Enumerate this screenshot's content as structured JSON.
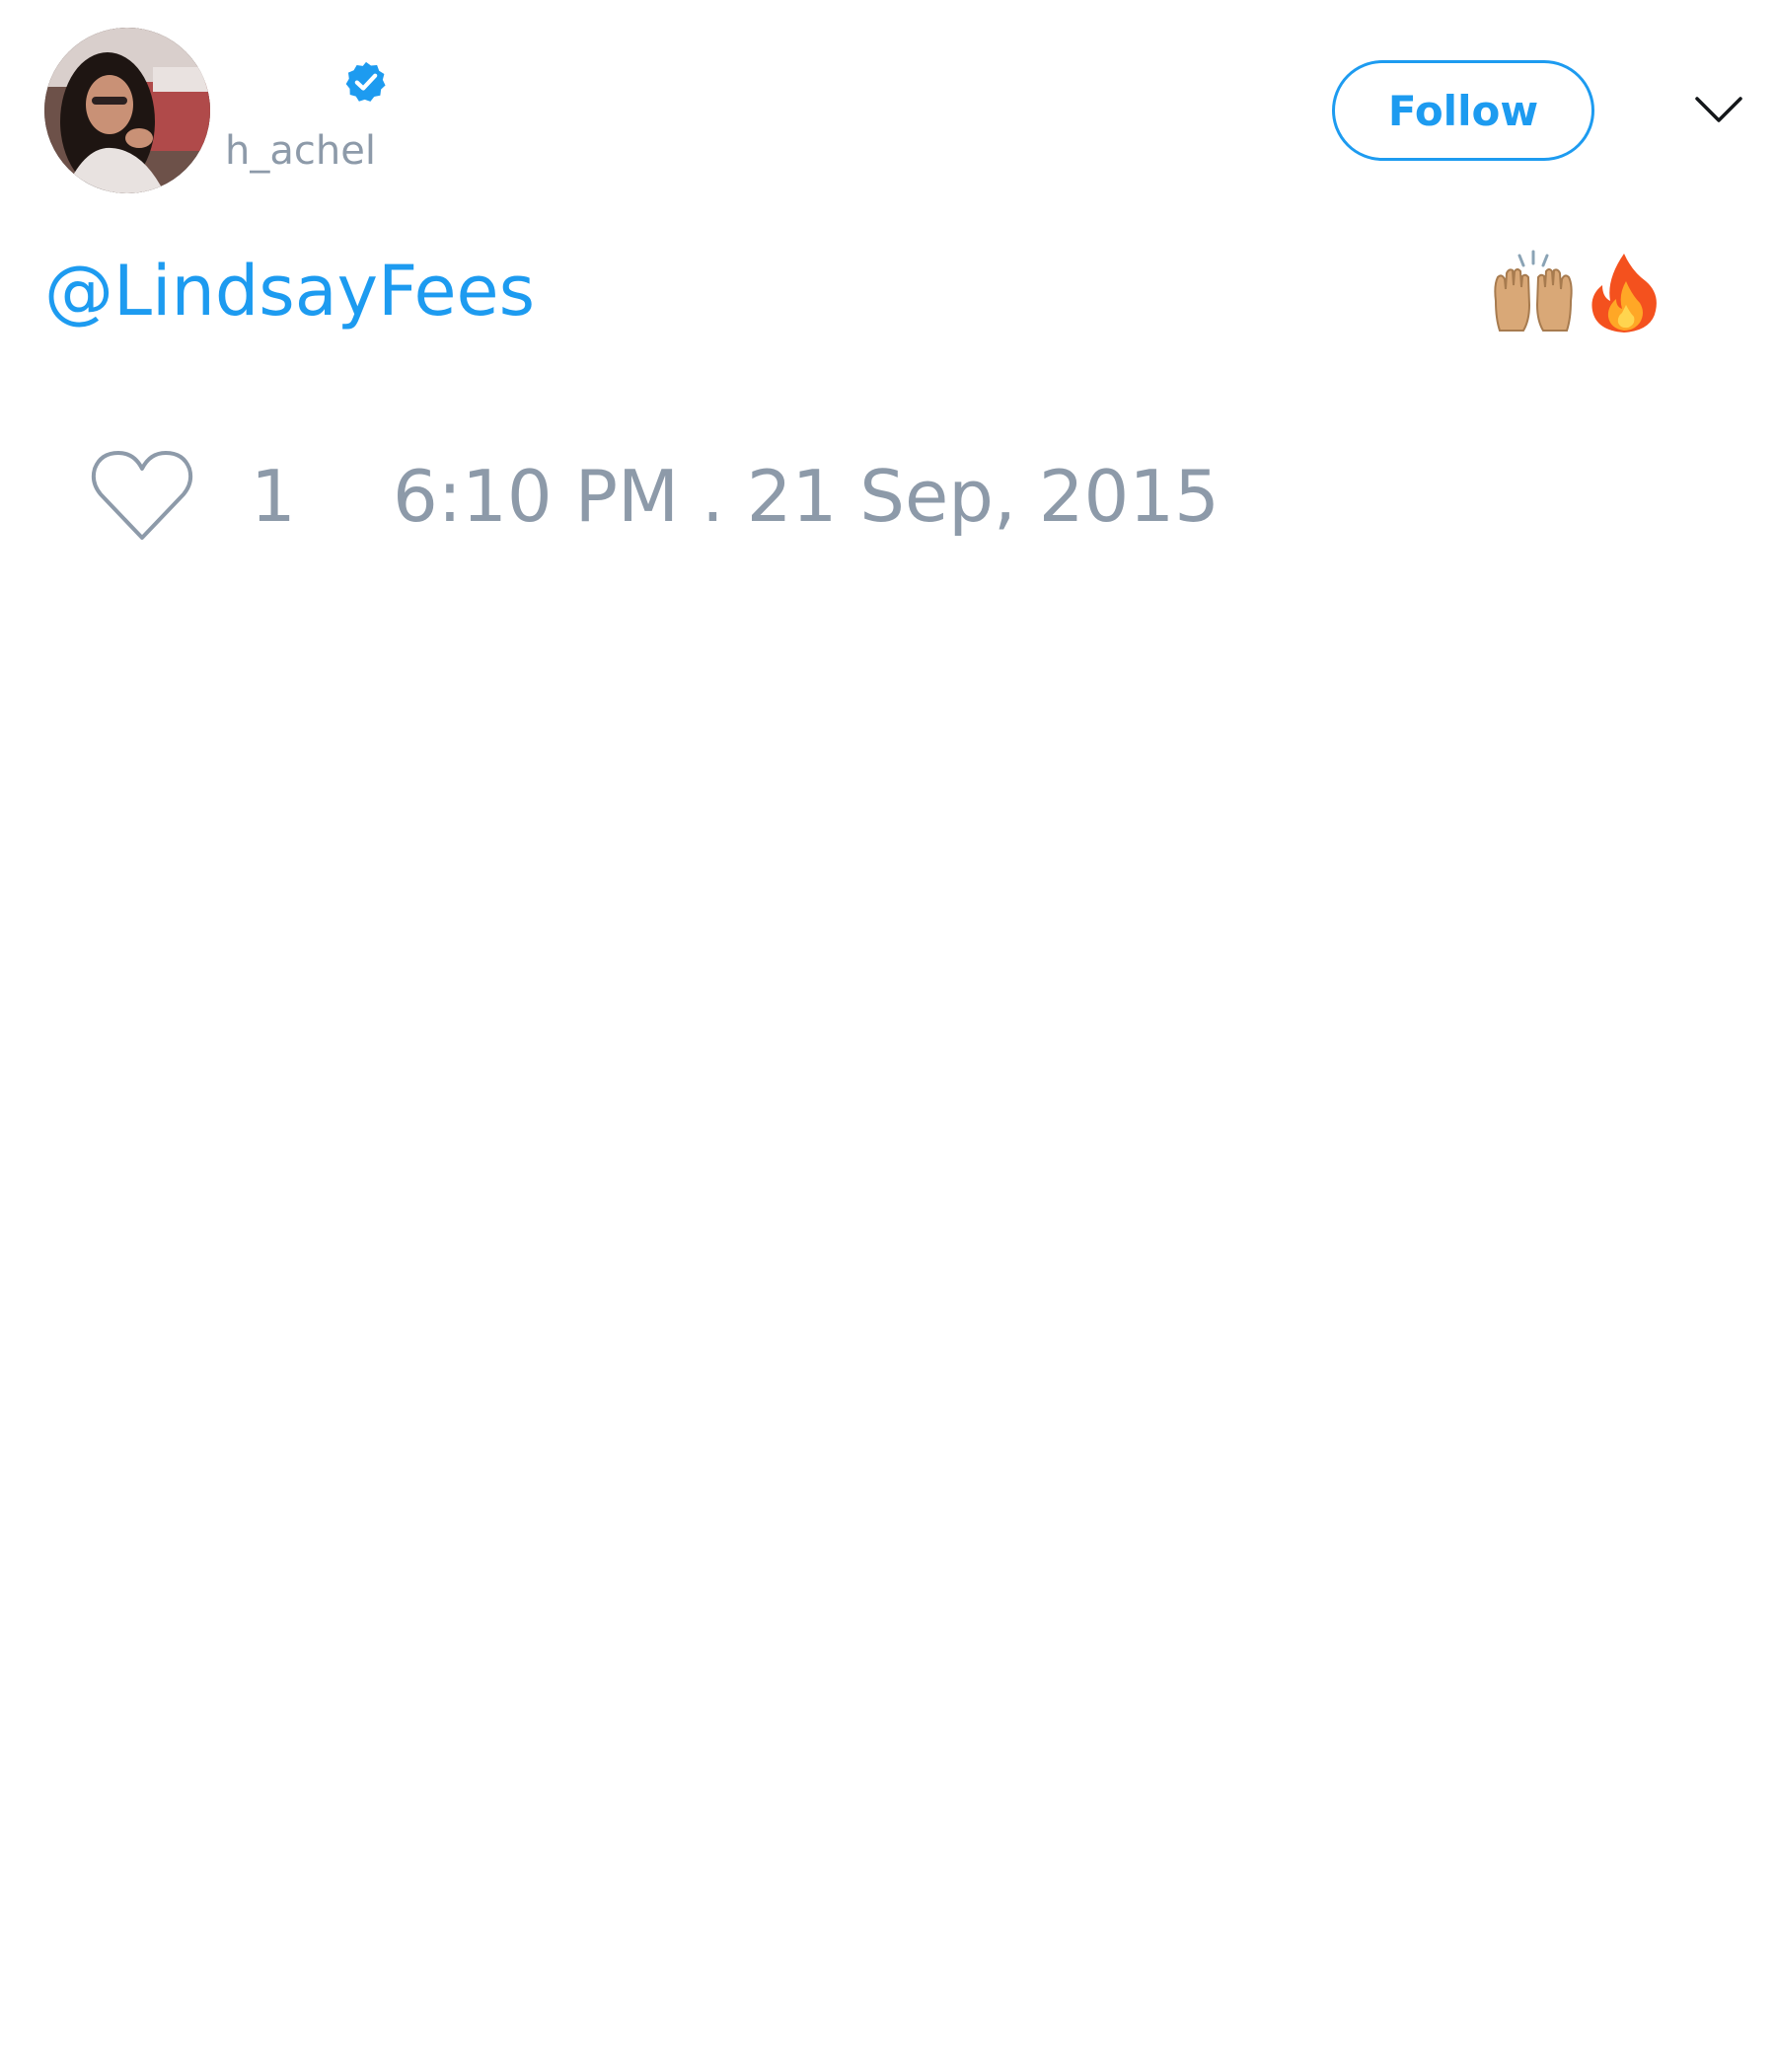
{
  "tweet": {
    "author": {
      "handle": "h_achel",
      "verified": true
    },
    "follow_label": "Follow",
    "mention": "@LindsayFees",
    "emojis": [
      "raising-hands-emoji",
      "fire-emoji"
    ],
    "likes": "1",
    "timestamp": "6:10 PM . 21 Sep, 2015"
  },
  "colors": {
    "accent": "#1d9bf0",
    "meta": "#8d9aa9"
  },
  "icons": {
    "verified": "verified-badge-icon",
    "menu": "chevron-down-icon",
    "like": "heart-icon"
  }
}
